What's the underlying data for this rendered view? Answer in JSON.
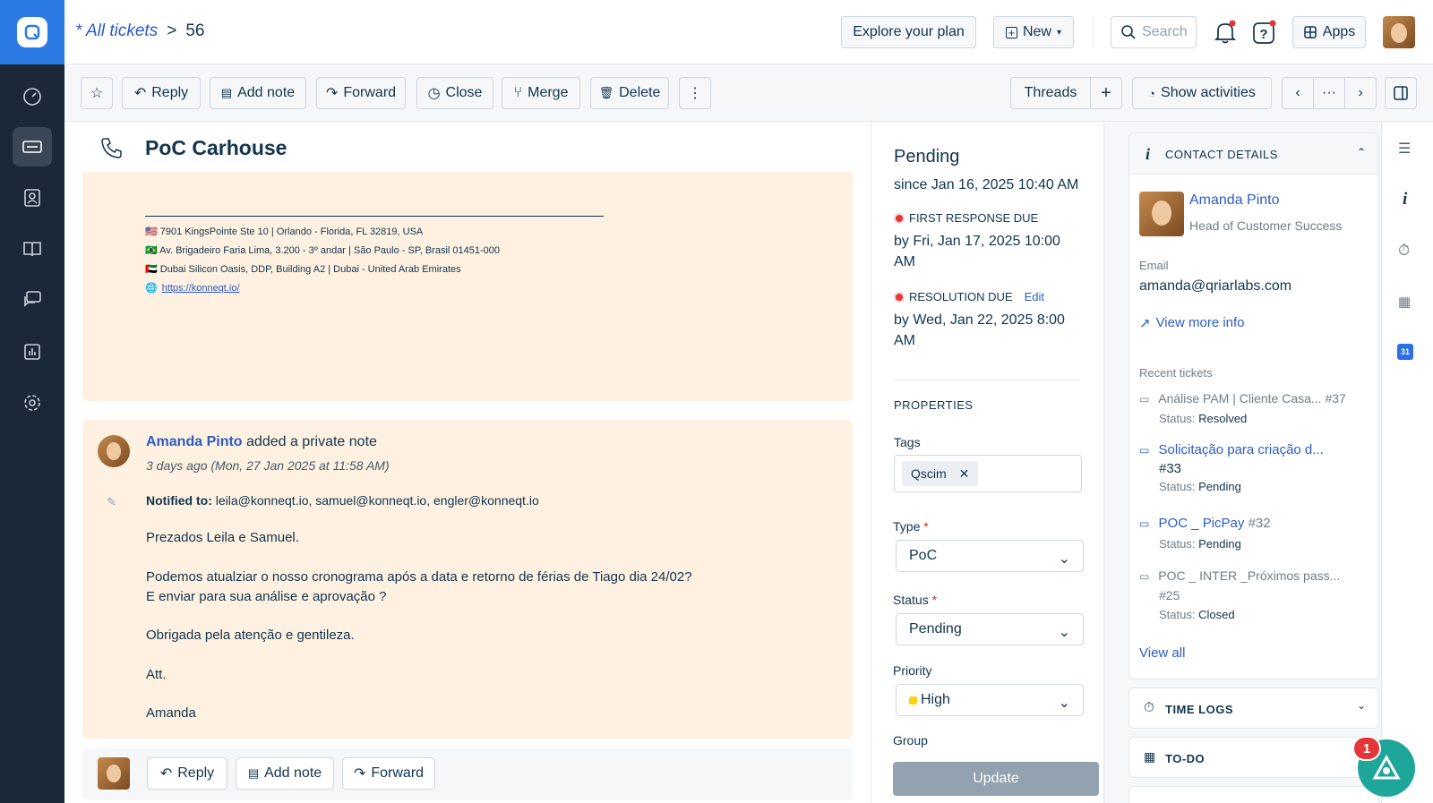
{
  "header": {
    "crumb_all": "* All tickets",
    "crumb_sep": ">",
    "ticket_id": "56",
    "explore": "Explore your plan",
    "new": "New",
    "search_placeholder": "Search",
    "apps": "Apps"
  },
  "toolbar": {
    "reply": "Reply",
    "add_note": "Add note",
    "forward": "Forward",
    "close": "Close",
    "merge": "Merge",
    "delete": "Delete",
    "threads": "Threads",
    "plus": "+",
    "show_activities": "Show activities",
    "more": "···"
  },
  "ticket": {
    "title": "PoC Carhouse"
  },
  "signature": {
    "line1": "🇺🇸 7901 KingsPointe Ste 10 | Orlando - Florida, FL 32819, USA",
    "line2": "🇧🇷 Av. Brigadeiro Faria Lima, 3.200 - 3º andar | São Paulo - SP, Brasil 01451-000",
    "line3": "🇦🇪 Dubai Silicon Oasis, DDP, Building A2 | Dubai - United Arab Emirates",
    "url": "https://konneqt.io/"
  },
  "note": {
    "author": "Amanda Pinto",
    "action": "added a private note",
    "time": "3 days ago (Mon, 27 Jan 2025 at 11:58 AM)",
    "notified_label": "Notified to:",
    "notified": "leila@konneqt.io, samuel@konneqt.io, engler@konneqt.io",
    "p1": "Prezados Leila e Samuel.",
    "p2": "Podemos atualziar o nosso cronograma após a data e retorno de férias de Tiago dia 24/02?",
    "p3": "E enviar para sua análise e aprovação ?",
    "p4": "Obrigada pela atenção e gentileza.",
    "p5": "Att.",
    "p6": "Amanda"
  },
  "bottom": {
    "reply": "Reply",
    "add_note": "Add note",
    "forward": "Forward"
  },
  "status_panel": {
    "status": "Pending",
    "since": "since Jan 16, 2025 10:40 AM",
    "frd_label": "FIRST RESPONSE DUE",
    "frd_value": "by Fri, Jan 17, 2025 10:00 AM",
    "rd_label": "RESOLUTION DUE",
    "rd_edit": "Edit",
    "rd_value": "by Wed, Jan 22, 2025 8:00 AM",
    "properties": "PROPERTIES",
    "tags_label": "Tags",
    "tag": "Qscim",
    "type_label": "Type",
    "type_value": "PoC",
    "status_label": "Status",
    "status_value": "Pending",
    "priority_label": "Priority",
    "priority_value": "High",
    "group_label": "Group",
    "update": "Update"
  },
  "contact": {
    "heading": "CONTACT DETAILS",
    "name": "Amanda Pinto",
    "role": "Head of Customer Success",
    "email_label": "Email",
    "email": "amanda@qriarlabs.com",
    "view_more": "View more info",
    "recent_label": "Recent tickets",
    "tickets": [
      {
        "title": "Análise PAM | Cliente Casa... #37",
        "status_label": "Status:",
        "status": "Resolved"
      },
      {
        "title": "Solicitação para criação d...",
        "num": "#33",
        "status_label": "Status:",
        "status": "Pending"
      },
      {
        "title": "POC _ PicPay",
        "num": "#32",
        "status_label": "Status:",
        "status": "Pending"
      },
      {
        "title": "POC _ INTER _Próximos pass...",
        "num": "#25",
        "status_label": "Status:",
        "status": "Closed"
      }
    ],
    "view_all": "View all"
  },
  "time_logs": "TIME LOGS",
  "todo": "TO-DO",
  "badge": "1",
  "calendar_day": "31",
  "colors": {
    "accent": "#2c5cc5",
    "sidebar": "#1b2838",
    "note_bg": "#fef1e1",
    "priority": "#ffd012"
  }
}
